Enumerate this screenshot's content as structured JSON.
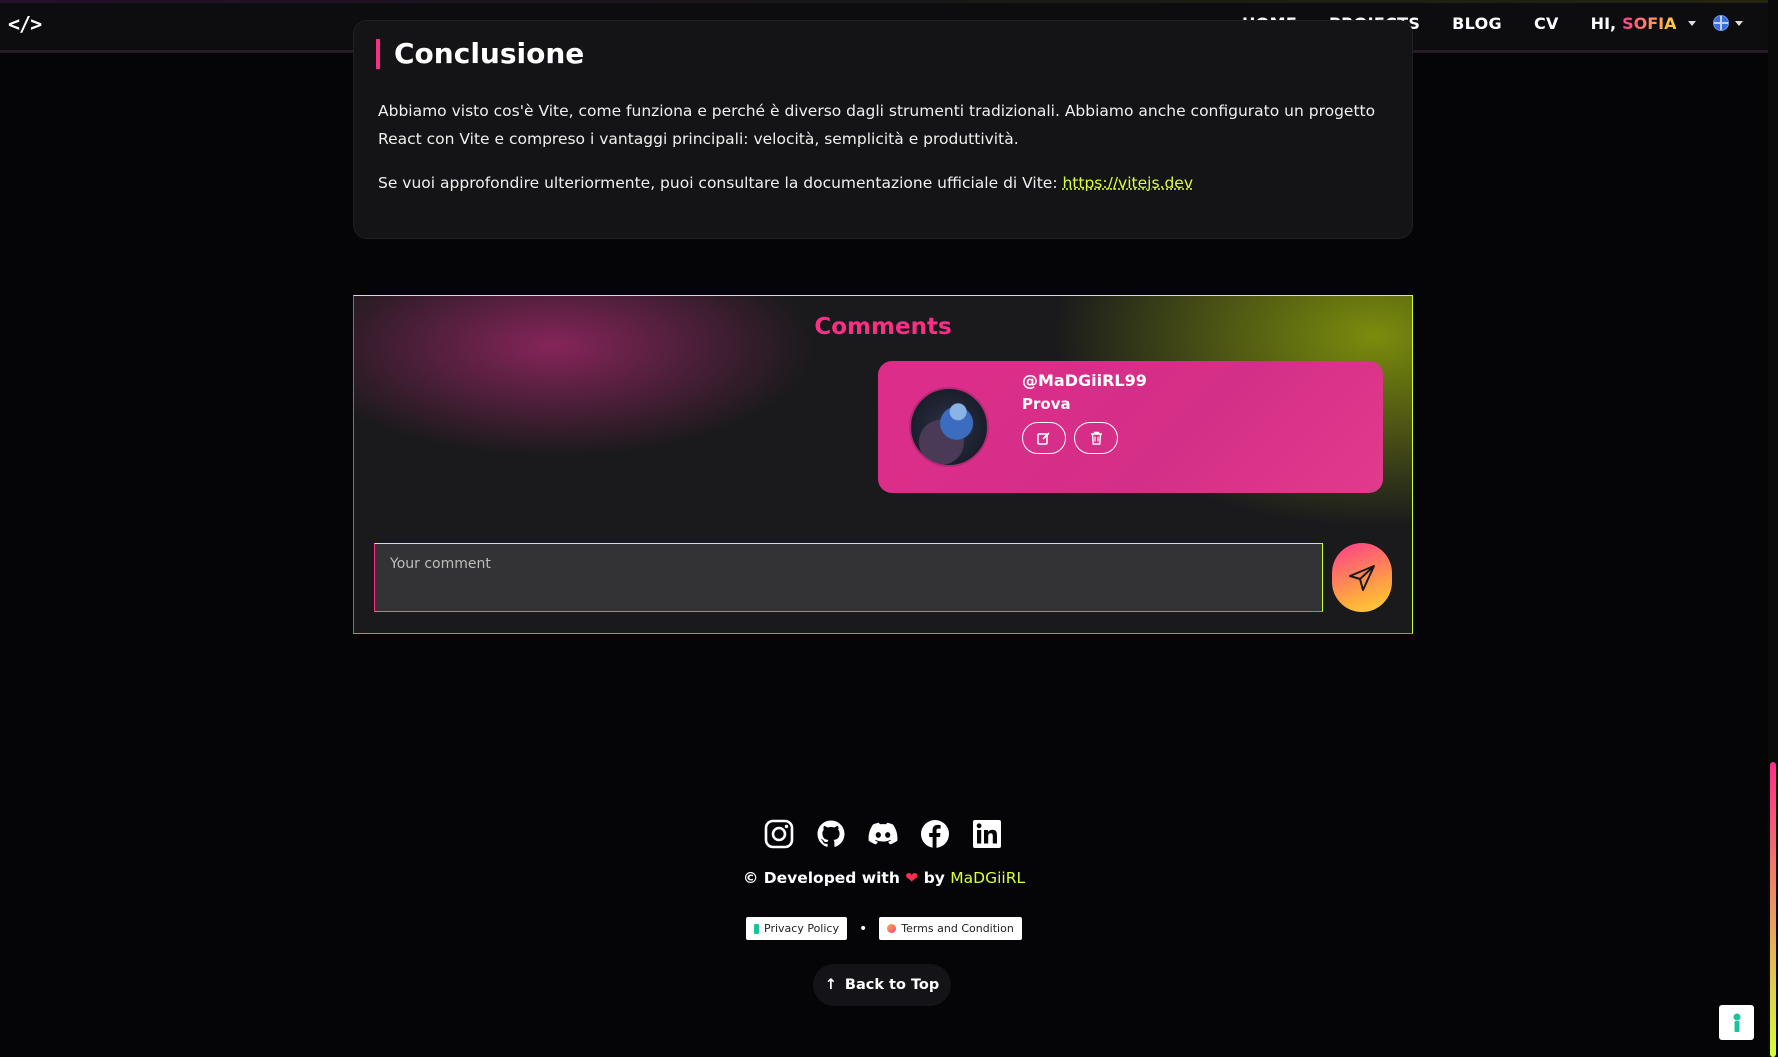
{
  "navbar": {
    "logo": "</>",
    "links": [
      "HOME",
      "PROJECTS",
      "BLOG",
      "CV"
    ],
    "greeting": "HI,",
    "user_name": "SOFIA"
  },
  "article": {
    "section_title": "Conclusione",
    "paragraph1": "Abbiamo visto cos'è Vite, come funziona e perché è diverso dagli strumenti tradizionali. Abbiamo anche configurato un progetto React con Vite e compreso i vantaggi principali: velocità, semplicità e produttività.",
    "paragraph2_text": "Se vuoi approfondire ulteriormente, puoi consultare la documentazione ufficiale di Vite: ",
    "paragraph2_link": "https://vitejs.dev"
  },
  "comments": {
    "title": "Comments",
    "items": [
      {
        "username": "@MaDGiiRL99",
        "text": "Prova",
        "avatar": "user-avatar"
      }
    ],
    "input_placeholder": "Your comment"
  },
  "footer": {
    "socials": [
      "instagram-icon",
      "github-icon",
      "discord-icon",
      "facebook-icon",
      "linkedin-icon"
    ],
    "credit_prefix": "© Developed with",
    "credit_by": "by",
    "author": "MaDGiiRL",
    "privacy": "Privacy Policy",
    "separator": "•",
    "terms": "Terms and Condition",
    "back_to_top": "Back to Top"
  },
  "colors": {
    "accent_pink": "#ff2d86",
    "accent_lime": "#d7ff3a",
    "comment_card": "#dd2d8a",
    "background": "#050508"
  }
}
